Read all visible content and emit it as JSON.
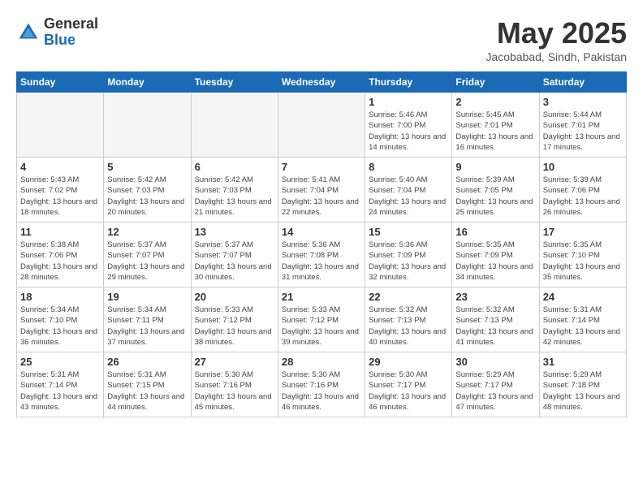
{
  "logo": {
    "general": "General",
    "blue": "Blue"
  },
  "title": {
    "month_year": "May 2025",
    "location": "Jacobabad, Sindh, Pakistan"
  },
  "headers": [
    "Sunday",
    "Monday",
    "Tuesday",
    "Wednesday",
    "Thursday",
    "Friday",
    "Saturday"
  ],
  "weeks": [
    [
      {
        "day": "",
        "empty": true
      },
      {
        "day": "",
        "empty": true
      },
      {
        "day": "",
        "empty": true
      },
      {
        "day": "",
        "empty": true
      },
      {
        "day": "1",
        "sunrise": "5:46 AM",
        "sunset": "7:00 PM",
        "daylight": "Daylight: 13 hours and 14 minutes."
      },
      {
        "day": "2",
        "sunrise": "5:45 AM",
        "sunset": "7:01 PM",
        "daylight": "Daylight: 13 hours and 16 minutes."
      },
      {
        "day": "3",
        "sunrise": "5:44 AM",
        "sunset": "7:01 PM",
        "daylight": "Daylight: 13 hours and 17 minutes."
      }
    ],
    [
      {
        "day": "4",
        "sunrise": "5:43 AM",
        "sunset": "7:02 PM",
        "daylight": "Daylight: 13 hours and 18 minutes."
      },
      {
        "day": "5",
        "sunrise": "5:42 AM",
        "sunset": "7:03 PM",
        "daylight": "Daylight: 13 hours and 20 minutes."
      },
      {
        "day": "6",
        "sunrise": "5:42 AM",
        "sunset": "7:03 PM",
        "daylight": "Daylight: 13 hours and 21 minutes."
      },
      {
        "day": "7",
        "sunrise": "5:41 AM",
        "sunset": "7:04 PM",
        "daylight": "Daylight: 13 hours and 22 minutes."
      },
      {
        "day": "8",
        "sunrise": "5:40 AM",
        "sunset": "7:04 PM",
        "daylight": "Daylight: 13 hours and 24 minutes."
      },
      {
        "day": "9",
        "sunrise": "5:39 AM",
        "sunset": "7:05 PM",
        "daylight": "Daylight: 13 hours and 25 minutes."
      },
      {
        "day": "10",
        "sunrise": "5:39 AM",
        "sunset": "7:06 PM",
        "daylight": "Daylight: 13 hours and 26 minutes."
      }
    ],
    [
      {
        "day": "11",
        "sunrise": "5:38 AM",
        "sunset": "7:06 PM",
        "daylight": "Daylight: 13 hours and 28 minutes."
      },
      {
        "day": "12",
        "sunrise": "5:37 AM",
        "sunset": "7:07 PM",
        "daylight": "Daylight: 13 hours and 29 minutes."
      },
      {
        "day": "13",
        "sunrise": "5:37 AM",
        "sunset": "7:07 PM",
        "daylight": "Daylight: 13 hours and 30 minutes."
      },
      {
        "day": "14",
        "sunrise": "5:36 AM",
        "sunset": "7:08 PM",
        "daylight": "Daylight: 13 hours and 31 minutes."
      },
      {
        "day": "15",
        "sunrise": "5:36 AM",
        "sunset": "7:09 PM",
        "daylight": "Daylight: 13 hours and 32 minutes."
      },
      {
        "day": "16",
        "sunrise": "5:35 AM",
        "sunset": "7:09 PM",
        "daylight": "Daylight: 13 hours and 34 minutes."
      },
      {
        "day": "17",
        "sunrise": "5:35 AM",
        "sunset": "7:10 PM",
        "daylight": "Daylight: 13 hours and 35 minutes."
      }
    ],
    [
      {
        "day": "18",
        "sunrise": "5:34 AM",
        "sunset": "7:10 PM",
        "daylight": "Daylight: 13 hours and 36 minutes."
      },
      {
        "day": "19",
        "sunrise": "5:34 AM",
        "sunset": "7:11 PM",
        "daylight": "Daylight: 13 hours and 37 minutes."
      },
      {
        "day": "20",
        "sunrise": "5:33 AM",
        "sunset": "7:12 PM",
        "daylight": "Daylight: 13 hours and 38 minutes."
      },
      {
        "day": "21",
        "sunrise": "5:33 AM",
        "sunset": "7:12 PM",
        "daylight": "Daylight: 13 hours and 39 minutes."
      },
      {
        "day": "22",
        "sunrise": "5:32 AM",
        "sunset": "7:13 PM",
        "daylight": "Daylight: 13 hours and 40 minutes."
      },
      {
        "day": "23",
        "sunrise": "5:32 AM",
        "sunset": "7:13 PM",
        "daylight": "Daylight: 13 hours and 41 minutes."
      },
      {
        "day": "24",
        "sunrise": "5:31 AM",
        "sunset": "7:14 PM",
        "daylight": "Daylight: 13 hours and 42 minutes."
      }
    ],
    [
      {
        "day": "25",
        "sunrise": "5:31 AM",
        "sunset": "7:14 PM",
        "daylight": "Daylight: 13 hours and 43 minutes."
      },
      {
        "day": "26",
        "sunrise": "5:31 AM",
        "sunset": "7:15 PM",
        "daylight": "Daylight: 13 hours and 44 minutes."
      },
      {
        "day": "27",
        "sunrise": "5:30 AM",
        "sunset": "7:16 PM",
        "daylight": "Daylight: 13 hours and 45 minutes."
      },
      {
        "day": "28",
        "sunrise": "5:30 AM",
        "sunset": "7:16 PM",
        "daylight": "Daylight: 13 hours and 46 minutes."
      },
      {
        "day": "29",
        "sunrise": "5:30 AM",
        "sunset": "7:17 PM",
        "daylight": "Daylight: 13 hours and 46 minutes."
      },
      {
        "day": "30",
        "sunrise": "5:29 AM",
        "sunset": "7:17 PM",
        "daylight": "Daylight: 13 hours and 47 minutes."
      },
      {
        "day": "31",
        "sunrise": "5:29 AM",
        "sunset": "7:18 PM",
        "daylight": "Daylight: 13 hours and 48 minutes."
      }
    ]
  ]
}
